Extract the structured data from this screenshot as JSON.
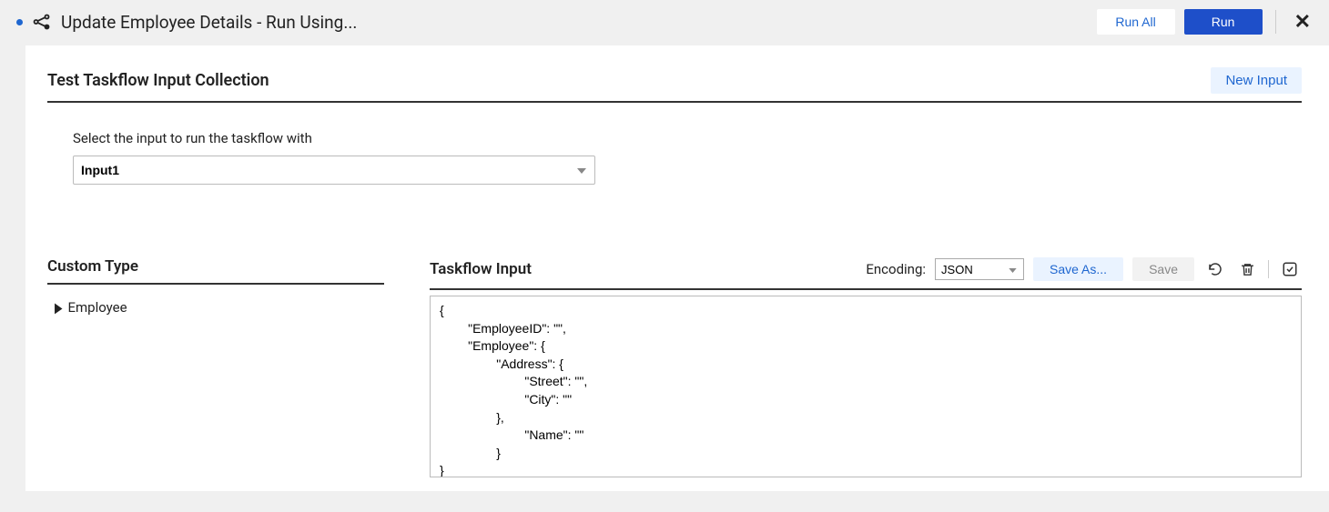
{
  "header": {
    "title": "Update Employee Details - Run Using...",
    "run_all_label": "Run All",
    "run_label": "Run"
  },
  "panel": {
    "title": "Test Taskflow Input Collection",
    "new_input_label": "New Input",
    "select_label": "Select the input to run the taskflow with",
    "selected_input": "Input1"
  },
  "custom_type": {
    "heading": "Custom Type",
    "items": [
      "Employee"
    ]
  },
  "taskflow_input": {
    "heading": "Taskflow Input",
    "encoding_label": "Encoding:",
    "encoding_value": "JSON",
    "save_as_label": "Save As...",
    "save_label": "Save",
    "json_text": "{\n        \"EmployeeID\": \"\",\n        \"Employee\": {\n                \"Address\": {\n                        \"Street\": \"\",\n                        \"City\": \"\"\n                },\n                        \"Name\": \"\"\n                }\n}"
  }
}
